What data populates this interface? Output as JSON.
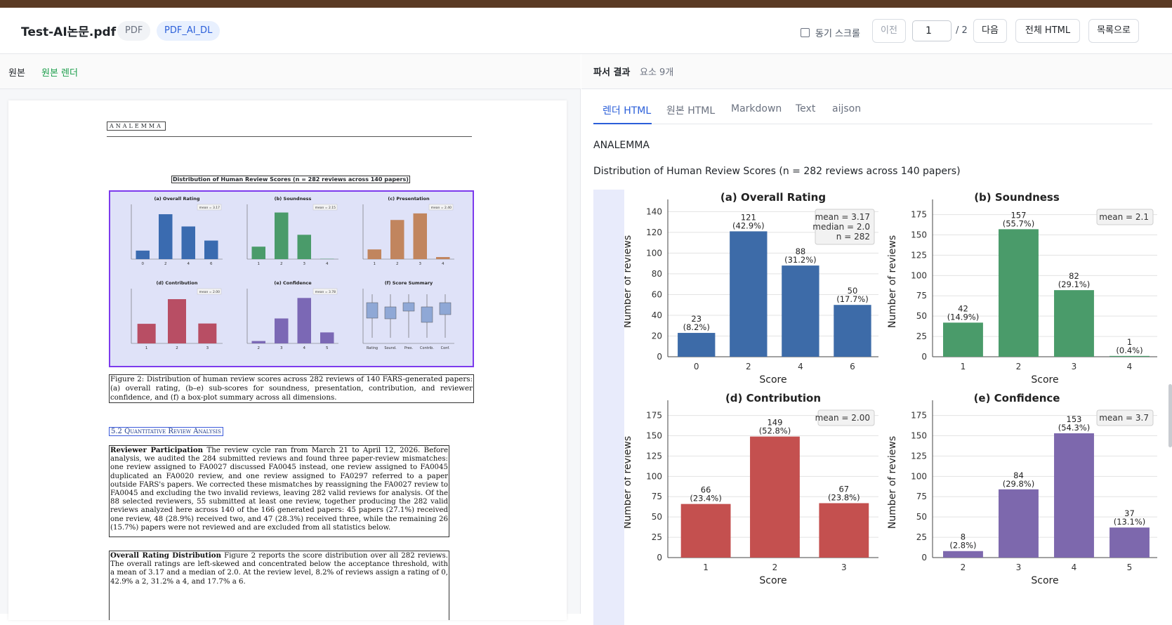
{
  "header": {
    "file_title": "Test-AI논문.pdf",
    "badge_format": "PDF",
    "badge_type": "PDF_AI_DL",
    "sync_label": "동기 스크롤",
    "prev_label": "이전",
    "page_value": "1",
    "page_total": "/ 2",
    "next_label": "다음",
    "full_html_label": "전체 HTML",
    "list_label": "목록으로"
  },
  "left": {
    "label": "원본",
    "render_label": "원본 렌더",
    "paper": {
      "logo": "ANALEMMA",
      "fig_title": "Distribution of Human Review Scores (n = 282 reviews across 140 papers)",
      "caption": "Figure 2: Distribution of human review scores across 282 reviews of 140 FARS-generated papers: (a) overall rating, (b–e) sub-scores for soundness, presentation, contribution, and reviewer confidence, and (f) a box-plot summary across all dimensions.",
      "section": "5.2   Quantitative Review Analysis",
      "para1_head": "Reviewer Participation",
      "para1": "The review cycle ran from March 21 to April 12, 2026. Before analysis, we audited the 284 submitted reviews and found three paper-review mismatches: one review assigned to FA0027 discussed FA0045 instead, one review assigned to FA0045 duplicated an FA0020 review, and one review assigned to FA0297 referred to a paper outside FARS's papers. We corrected these mismatches by reassigning the FA0027 review to FA0045 and excluding the two invalid reviews, leaving 282 valid reviews for analysis. Of the 88 selected reviewers, 55 submitted at least one review, together producing the 282 valid reviews analyzed here across 140 of the 166 generated papers: 45 papers (27.1%) received one review, 48 (28.9%) received two, and 47 (28.3%) received three, while the remaining 26 (15.7%) papers were not reviewed and are excluded from all statistics below.",
      "para2_head": "Overall Rating Distribution",
      "para2": "Figure 2 reports the score distribution over all 282 reviews. The overall ratings are left-skewed and concentrated below the acceptance threshold, with a mean of 3.17 and a median of 2.0. At the review level, 8.2% of reviews assign a rating of 0, 42.9% a 2, 31.2% a 4, and 17.7% a 6."
    },
    "mini_charts": [
      {
        "title": "(a) Overall Rating",
        "color": "#3a6bb0",
        "cats": [
          "0",
          "2",
          "4",
          "6"
        ],
        "values": [
          23,
          121,
          88,
          50
        ],
        "ymax": 140,
        "stat": "mean = 3.17"
      },
      {
        "title": "(b) Soundness",
        "color": "#4a9b6a",
        "cats": [
          "1",
          "2",
          "3",
          "4"
        ],
        "values": [
          42,
          157,
          82,
          1
        ],
        "ymax": 175,
        "stat": "mean = 2.15"
      },
      {
        "title": "(c) Presentation",
        "color": "#c1855e",
        "cats": [
          "1",
          "2",
          "3",
          "4"
        ],
        "values": [
          28,
          113,
          132,
          6
        ],
        "ymax": 150,
        "stat": "mean = 2.40"
      },
      {
        "title": "(d) Contribution",
        "color": "#b84e64",
        "cats": [
          "1",
          "2",
          "3"
        ],
        "values": [
          66,
          149,
          67
        ],
        "ymax": 175,
        "stat": "mean = 2.00"
      },
      {
        "title": "(e) Confidence",
        "color": "#7b68b5",
        "cats": [
          "2",
          "3",
          "4",
          "5"
        ],
        "values": [
          8,
          84,
          153,
          37
        ],
        "ymax": 175,
        "stat": "mean = 3.78"
      },
      {
        "title": "(f) Score Summary",
        "color": "#8fa8d6",
        "cats": [
          "Rating",
          "Sound.",
          "Pres.",
          "Contrib.",
          "Conf."
        ],
        "values": [],
        "ymax": 6,
        "stat": ""
      }
    ]
  },
  "right": {
    "label": "파서 결과",
    "count": "요소 9개",
    "tabs": [
      "렌더 HTML",
      "원본 HTML",
      "Markdown",
      "Text",
      "aijson"
    ],
    "line1": "ANALEMMA",
    "line2": "Distribution of Human Review Scores (n = 282 reviews across 140 papers)"
  },
  "chart_data": [
    {
      "type": "bar",
      "title": "(a) Overall Rating",
      "categories": [
        "0",
        "2",
        "4",
        "6"
      ],
      "values": [
        23,
        121,
        88,
        50
      ],
      "labels": [
        "23\n(8.2%)",
        "121\n(42.9%)",
        "88\n(31.2%)",
        "50\n(17.7%)"
      ],
      "xlabel": "Score",
      "ylabel": "Number of reviews",
      "ylim": [
        0,
        145
      ],
      "yticks": [
        0,
        20,
        40,
        60,
        80,
        100,
        120,
        140
      ],
      "annotation": [
        "mean = 3.17",
        "median = 2.0",
        "n = 282"
      ],
      "color": "#3d6ba8"
    },
    {
      "type": "bar",
      "title": "(b) Soundness",
      "categories": [
        "1",
        "2",
        "3",
        "4"
      ],
      "values": [
        42,
        157,
        82,
        1
      ],
      "labels": [
        "42\n(14.9%)",
        "157\n(55.7%)",
        "82\n(29.1%)",
        "1\n(0.4%)"
      ],
      "xlabel": "Score",
      "ylabel": "Number of reviews",
      "ylim": [
        0,
        185
      ],
      "yticks": [
        0,
        25,
        50,
        75,
        100,
        125,
        150,
        175
      ],
      "annotation": [
        "mean = 2.1"
      ],
      "color": "#4a9b6a"
    },
    {
      "type": "bar",
      "title": "(d) Contribution",
      "categories": [
        "1",
        "2",
        "3"
      ],
      "values": [
        66,
        149,
        67
      ],
      "labels": [
        "66\n(23.4%)",
        "149\n(52.8%)",
        "67\n(23.8%)"
      ],
      "xlabel": "Score",
      "ylabel": "Number of reviews",
      "ylim": [
        0,
        185
      ],
      "yticks": [
        0,
        25,
        50,
        75,
        100,
        125,
        150,
        175
      ],
      "annotation": [
        "mean = 2.00"
      ],
      "color": "#c4504f"
    },
    {
      "type": "bar",
      "title": "(e) Confidence",
      "categories": [
        "2",
        "3",
        "4",
        "5"
      ],
      "values": [
        8,
        84,
        153,
        37
      ],
      "labels": [
        "8\n(2.8%)",
        "84\n(29.8%)",
        "153\n(54.3%)",
        "37\n(13.1%)"
      ],
      "xlabel": "Score",
      "ylabel": "Number of reviews",
      "ylim": [
        0,
        185
      ],
      "yticks": [
        0,
        25,
        50,
        75,
        100,
        125,
        150,
        175
      ],
      "annotation": [
        "mean = 3.7"
      ],
      "color": "#7d68ad"
    }
  ]
}
